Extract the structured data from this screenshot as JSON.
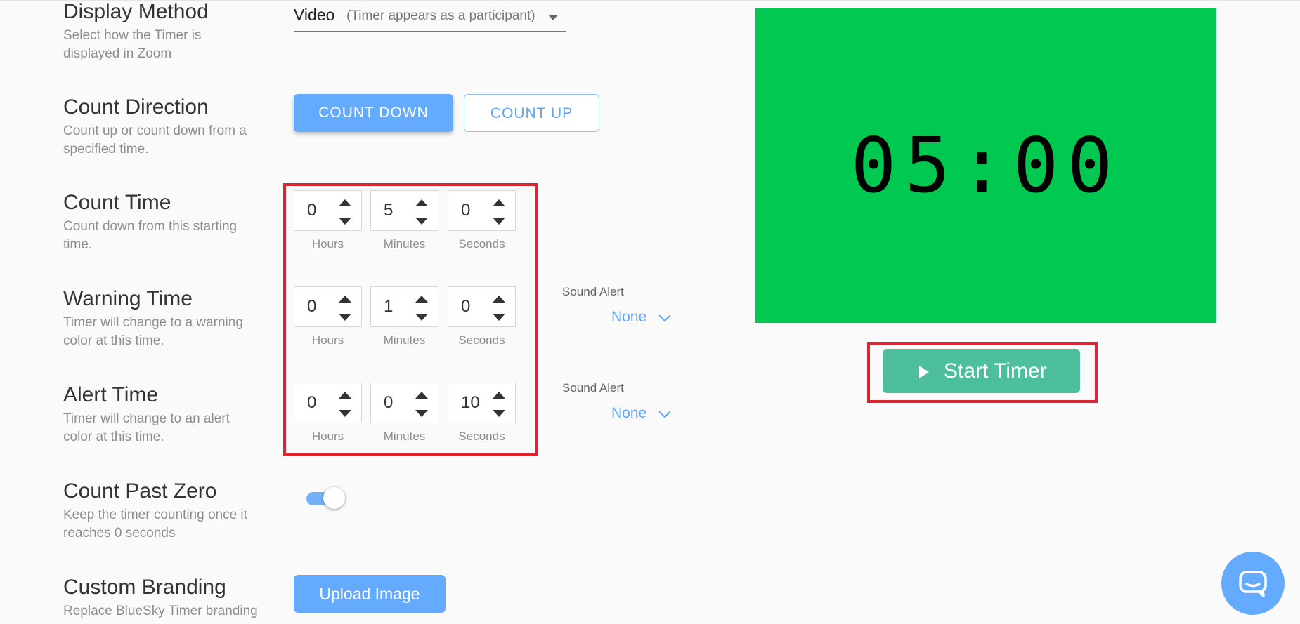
{
  "display_method": {
    "title": "Display Method",
    "description": "Select how the Timer is displayed in Zoom",
    "value": "Video",
    "sublabel": "(Timer appears as a participant)"
  },
  "count_direction": {
    "title": "Count Direction",
    "description": "Count up or count down from a specified time.",
    "options": [
      "COUNT DOWN",
      "COUNT UP"
    ],
    "selected": "COUNT DOWN"
  },
  "count_time": {
    "title": "Count Time",
    "description": "Count down from this starting time.",
    "hours": "0",
    "minutes": "5",
    "seconds": "0"
  },
  "warning_time": {
    "title": "Warning Time",
    "description": "Timer will change to a warning color at this time.",
    "hours": "0",
    "minutes": "1",
    "seconds": "0",
    "sound_alert_label": "Sound Alert",
    "sound_alert_value": "None"
  },
  "alert_time": {
    "title": "Alert Time",
    "description": "Timer will change to an alert color at this time.",
    "hours": "0",
    "minutes": "0",
    "seconds": "10",
    "sound_alert_label": "Sound Alert",
    "sound_alert_value": "None"
  },
  "units": {
    "hours": "Hours",
    "minutes": "Minutes",
    "seconds": "Seconds"
  },
  "count_past_zero": {
    "title": "Count Past Zero",
    "description": "Keep the timer counting once it reaches 0 seconds",
    "enabled": true
  },
  "custom_branding": {
    "title": "Custom Branding",
    "description": "Replace BlueSky Timer branding",
    "button": "Upload Image"
  },
  "preview": {
    "time": "05:00",
    "background": "#00c851"
  },
  "start_button": {
    "label": "Start Timer"
  },
  "colors": {
    "accent": "#64aaff",
    "start": "#4dbf9e",
    "highlight": "#e0242f"
  }
}
